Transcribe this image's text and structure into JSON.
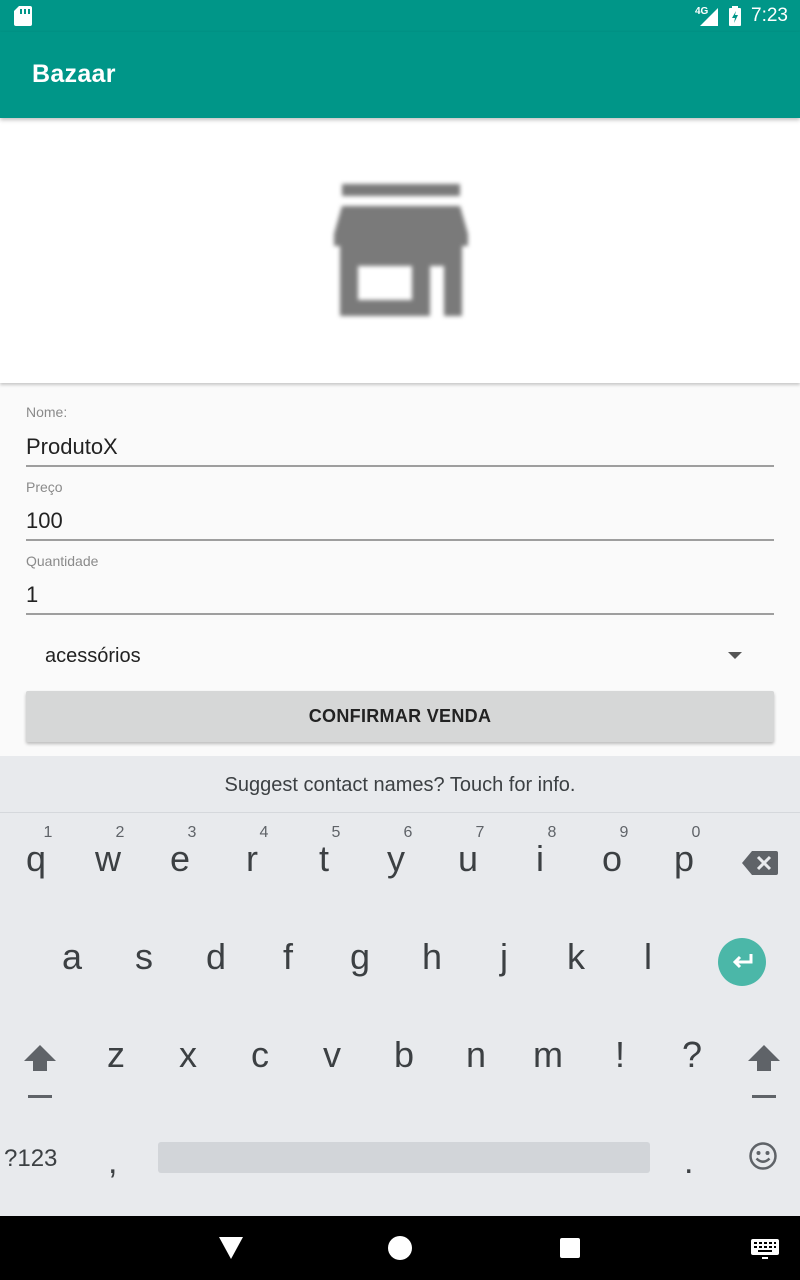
{
  "status_bar": {
    "network": "4G",
    "time": "7:23",
    "icons": [
      "sd-card-icon",
      "signal-icon",
      "battery-charging-icon"
    ]
  },
  "app_bar": {
    "title": "Bazaar"
  },
  "header": {
    "icon": "store-icon"
  },
  "form": {
    "name_label": "Nome:",
    "name_value": "ProdutoX",
    "price_label": "Preço",
    "price_value": "100",
    "quantity_label": "Quantidade",
    "quantity_value": "1",
    "category_value": "acessórios",
    "confirm_label": "CONFIRMAR VENDA"
  },
  "keyboard": {
    "suggestion": "Suggest contact names? Touch for info.",
    "row1": [
      {
        "char": "q",
        "hint": "1"
      },
      {
        "char": "w",
        "hint": "2"
      },
      {
        "char": "e",
        "hint": "3"
      },
      {
        "char": "r",
        "hint": "4"
      },
      {
        "char": "t",
        "hint": "5"
      },
      {
        "char": "y",
        "hint": "6"
      },
      {
        "char": "u",
        "hint": "7"
      },
      {
        "char": "i",
        "hint": "8"
      },
      {
        "char": "o",
        "hint": "9"
      },
      {
        "char": "p",
        "hint": "0"
      }
    ],
    "row2": [
      "a",
      "s",
      "d",
      "f",
      "g",
      "h",
      "j",
      "k",
      "l"
    ],
    "row3": [
      "z",
      "x",
      "c",
      "v",
      "b",
      "n",
      "m",
      "!",
      "?"
    ],
    "symbols_label": "?123",
    "comma": ",",
    "period": ".",
    "accent_color": "#4bb7a8"
  },
  "colors": {
    "primary": "#009688",
    "keyboard_bg": "#e8eaed"
  },
  "nav_bar": {
    "icons": [
      "back-icon",
      "home-icon",
      "recents-icon",
      "keyboard-switch-icon"
    ]
  }
}
